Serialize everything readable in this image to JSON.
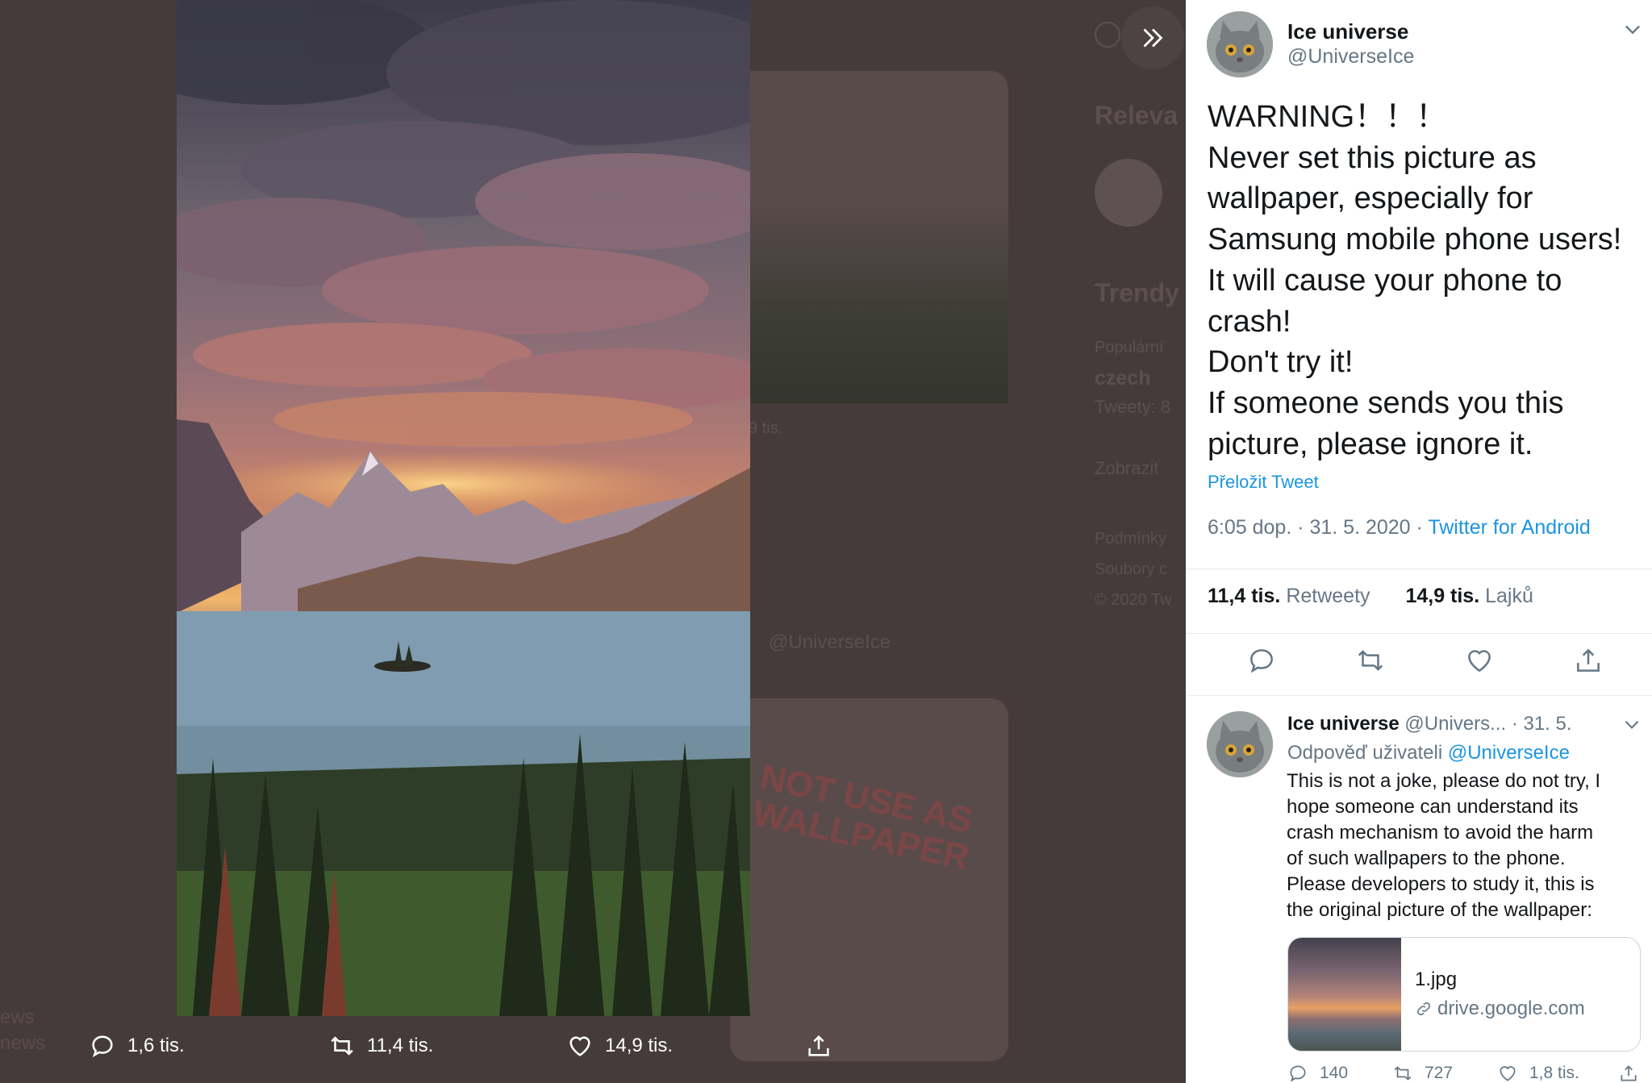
{
  "background": {
    "partial_texts": [
      "Releva",
      "Trendy",
      "Populární",
      "czech",
      "Tweety: 8",
      "Zobrazit",
      "Podmínky",
      "Soubory c",
      "© 2020 Tw",
      "9 tis.",
      "@UniverseIce",
      "ews",
      "news"
    ],
    "card_text": "NOT USE AS WALLPAPER"
  },
  "media_actions": {
    "replies": "1,6 tis.",
    "retweets": "11,4 tis.",
    "likes": "14,9 tis."
  },
  "main_tweet": {
    "author_name": "Ice universe",
    "author_handle": "@UniverseIce",
    "lines": [
      "WARNING！！！",
      "Never set this picture as",
      "wallpaper, especially for",
      "Samsung mobile phone users!",
      "It will cause your phone to",
      "crash!",
      "Don't try it!",
      "If someone sends you this",
      "picture, please ignore it."
    ],
    "translate": "Přeložit Tweet",
    "timestamp": "6:05 dop. · 31. 5. 2020 · ",
    "source": "Twitter for Android",
    "retweets_count": "11,4 tis.",
    "retweets_label": "Retweety",
    "likes_count": "14,9 tis.",
    "likes_label": "Lajků"
  },
  "reply_tweet": {
    "author_name": "Ice universe",
    "author_handle": "@Univers...",
    "date": "· 31. 5.",
    "reply_to_label": "Odpověď uživateli",
    "reply_to_handle": "@UniverseIce",
    "lines": [
      "This is not a joke, please do not try, I",
      "hope someone can understand its",
      "crash mechanism to avoid the harm",
      "of such wallpapers to the phone.",
      "Please developers to study it, this is",
      "the original picture of the wallpaper:"
    ],
    "link_card": {
      "title": "1.jpg",
      "domain": "drive.google.com"
    },
    "replies": "140",
    "retweets": "727",
    "likes": "1,8 tis."
  },
  "colors": {
    "accent": "#1b95e0",
    "overlay": "#463b3b",
    "text": "#14171a",
    "muted": "#657786"
  }
}
